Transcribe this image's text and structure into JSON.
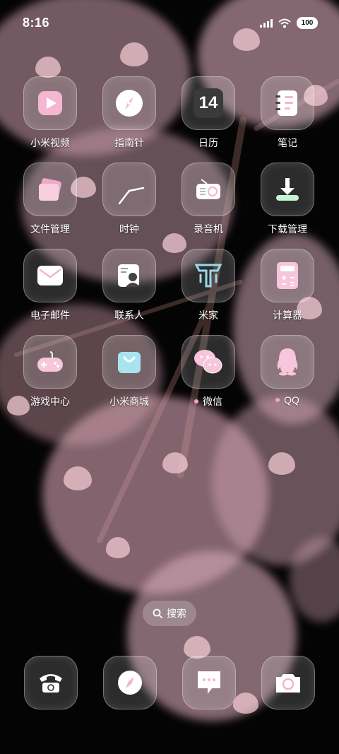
{
  "status_bar": {
    "time": "8:16",
    "battery": "100"
  },
  "apps": [
    {
      "label": "小米视频",
      "icon": "video-icon"
    },
    {
      "label": "指南针",
      "icon": "compass-icon"
    },
    {
      "label": "日历",
      "icon": "calendar-icon",
      "calendar_day": "14"
    },
    {
      "label": "笔记",
      "icon": "notes-icon"
    },
    {
      "label": "文件管理",
      "icon": "file-manager-icon"
    },
    {
      "label": "时钟",
      "icon": "clock-icon"
    },
    {
      "label": "录音机",
      "icon": "recorder-icon"
    },
    {
      "label": "下载管理",
      "icon": "download-icon"
    },
    {
      "label": "电子邮件",
      "icon": "mail-icon"
    },
    {
      "label": "联系人",
      "icon": "contacts-icon"
    },
    {
      "label": "米家",
      "icon": "mijia-icon"
    },
    {
      "label": "计算器",
      "icon": "calculator-icon"
    },
    {
      "label": "游戏中心",
      "icon": "gamepad-icon"
    },
    {
      "label": "小米商城",
      "icon": "shopping-bag-icon"
    },
    {
      "label": "微信",
      "icon": "wechat-icon",
      "new_dot": true
    },
    {
      "label": "QQ",
      "icon": "qq-icon",
      "new_dot": true
    }
  ],
  "search": {
    "label": "搜索"
  },
  "dock": [
    {
      "icon": "phone-icon"
    },
    {
      "icon": "browser-icon"
    },
    {
      "icon": "messages-icon"
    },
    {
      "icon": "camera-icon"
    }
  ]
}
